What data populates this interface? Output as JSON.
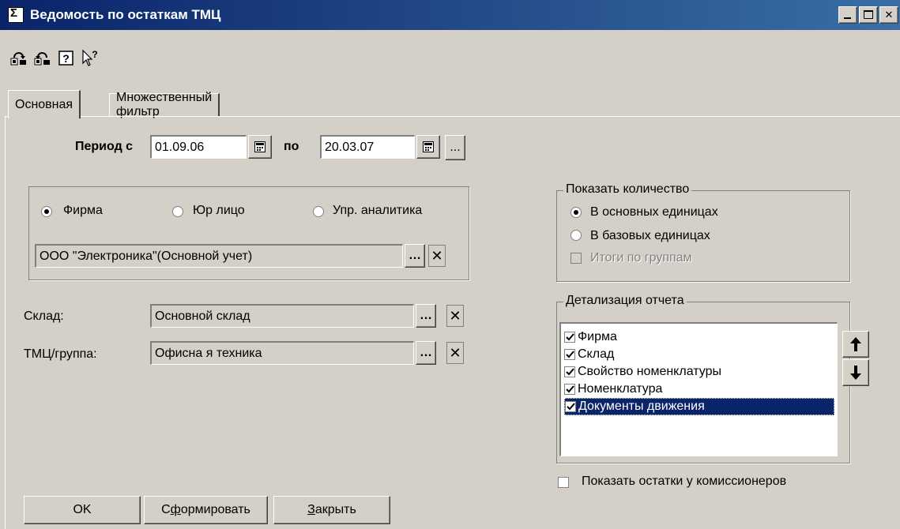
{
  "window": {
    "title": "Ведомость по остаткам ТМЦ",
    "controls": [
      "minimize",
      "maximize",
      "close"
    ]
  },
  "toolbar": {
    "icons": [
      "export-icon",
      "import-icon",
      "help-icon",
      "context-help-icon"
    ]
  },
  "tabs": [
    {
      "label": "Основная",
      "active": true
    },
    {
      "label": "Множественный фильтр",
      "active": false
    }
  ],
  "period": {
    "label_from": "Период с",
    "from": "01.09.06",
    "label_to": "по",
    "to": "20.03.07",
    "extra_button": "..."
  },
  "org_group": {
    "options": [
      {
        "label": "Фирма",
        "checked": true
      },
      {
        "label": "Юр лицо",
        "checked": false
      },
      {
        "label": "Упр. аналитика",
        "checked": false
      }
    ],
    "value": "ООО \"Электроника\"(Основной учет)"
  },
  "warehouse": {
    "label": "Склад:",
    "value": "Основной склад"
  },
  "goods": {
    "label": "ТМЦ/группа:",
    "value": "Офисна я техника"
  },
  "quantity": {
    "title": "Показать количество",
    "options": [
      {
        "label": "В основных единицах",
        "checked": true
      },
      {
        "label": "В базовых единицах",
        "checked": false
      }
    ],
    "totals_label": "Итоги по группам"
  },
  "details": {
    "title": "Детализация отчета",
    "items": [
      {
        "label": "Фирма",
        "checked": true,
        "selected": false
      },
      {
        "label": "Склад",
        "checked": true,
        "selected": false
      },
      {
        "label": "Свойство номенклатуры",
        "checked": true,
        "selected": false
      },
      {
        "label": "Номенклатура",
        "checked": true,
        "selected": false
      },
      {
        "label": "Документы движения",
        "checked": true,
        "selected": true
      }
    ]
  },
  "commission": {
    "label": "Показать остатки у комиссионеров",
    "checked": false
  },
  "buttons": {
    "ok": "OK",
    "generate_pre": "С",
    "generate_u": "ф",
    "generate_post": "ормировать",
    "close_u": "З",
    "close_post": "акрыть"
  }
}
